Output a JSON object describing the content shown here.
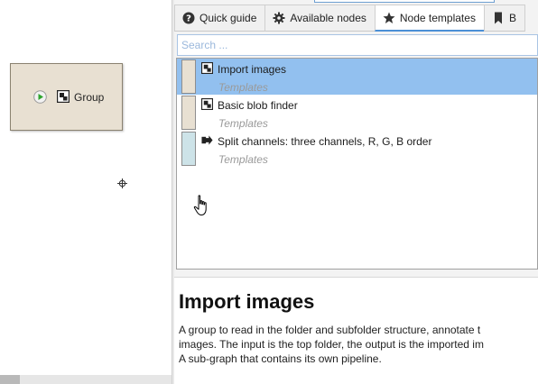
{
  "canvas": {
    "group_node": {
      "label": "Group",
      "fill_color": "#e8e0d2",
      "icons": [
        "play-icon",
        "group-icon"
      ]
    }
  },
  "tabs": [
    {
      "label": "Quick guide",
      "icon": "help-circle-icon",
      "active": false
    },
    {
      "label": "Available nodes",
      "icon": "gear-icon",
      "active": false
    },
    {
      "label": "Node templates",
      "icon": "star-icon",
      "active": true
    },
    {
      "label": "B",
      "icon": "bookmark-icon",
      "active": false
    }
  ],
  "search": {
    "placeholder": "Search ...",
    "value": ""
  },
  "templates": [
    {
      "name": "Import images",
      "category": "Templates",
      "swatch": "#e8e0d2",
      "icon": "group-icon",
      "selected": true
    },
    {
      "name": "Basic blob finder",
      "category": "Templates",
      "swatch": "#e8e0d2",
      "icon": "group-icon",
      "selected": false
    },
    {
      "name": "Split channels: three channels, R, G, B order",
      "category": "Templates",
      "swatch": "#cde3e8",
      "icon": "split-arrow-icon",
      "selected": false
    }
  ],
  "description": {
    "title": "Import images",
    "lines": [
      "A group to read in the folder and subfolder structure, annotate t",
      "images. The input is the top folder, the output is the imported im",
      "A sub-graph that contains its own pipeline."
    ]
  },
  "colors": {
    "selection": "#92c0ef",
    "accent": "#4a8fd6",
    "play": "#2ea52e"
  }
}
